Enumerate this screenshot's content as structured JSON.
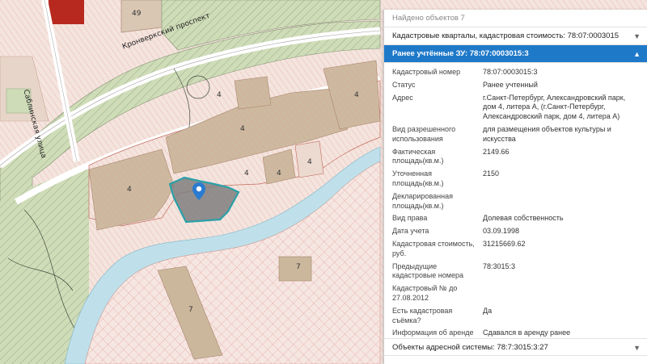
{
  "map": {
    "street_labels": [
      "Кронверкский проспект",
      "Саблинская улица"
    ],
    "building_number": "49",
    "zone_numbers": [
      "4",
      "4",
      "4",
      "4",
      "4",
      "4",
      "4",
      "7",
      "7"
    ],
    "colors": {
      "water": "#bfe0ea",
      "park": "#cfdcb8",
      "building": "#cbb79c",
      "red_hatch": "#e9b0a8",
      "selected": "#2aa0a8"
    }
  },
  "panel": {
    "found_text": "Найдено объектов 7",
    "sections": [
      {
        "label": "Кадастровые кварталы, кадастровая стоимость: 78:07:0003015",
        "state": "collapsed",
        "icon": "chevron-down-icon"
      },
      {
        "label": "Ранее учтённые ЗУ: 78:07:0003015:3",
        "state": "expanded",
        "icon": "chevron-up-icon"
      },
      {
        "label": "Объекты адресной системы: 78:7:3015:3:27",
        "state": "collapsed",
        "icon": "chevron-down-icon"
      }
    ],
    "properties": [
      {
        "key": "Кадастровый номер",
        "value": "78:07:0003015:3"
      },
      {
        "key": "Статус",
        "value": "Ранее учтенный"
      },
      {
        "key": "Адрес",
        "value": "г.Санкт-Петербург, Александровский парк, дом 4, литера А, (г.Санкт-Петербург, Александровский парк, дом 4, литера А)"
      },
      {
        "key": "Вид разрешенного использования",
        "value": "для размещения объектов культуры и искусства"
      },
      {
        "key": "Фактическая площадь(кв.м.)",
        "value": "2149.66"
      },
      {
        "key": "Уточненная площадь(кв.м.)",
        "value": "2150"
      },
      {
        "key": "Декларированная площадь(кв.м.)",
        "value": ""
      },
      {
        "key": "Вид права",
        "value": "Долевая собственность"
      },
      {
        "key": "Дата учета",
        "value": "03.09.1998"
      },
      {
        "key": "Кадастровая стоимость, руб.",
        "value": "31215669.62"
      },
      {
        "key": "Предыдущие кадастровые номера",
        "value": "78:3015:3"
      },
      {
        "key": "Кадастровый № до 27.08.2012",
        "value": ""
      },
      {
        "key": "Есть кадастровая съёмка?",
        "value": "Да"
      },
      {
        "key": "Информация об аренде",
        "value": "Сдавался в аренду ранее"
      }
    ]
  }
}
